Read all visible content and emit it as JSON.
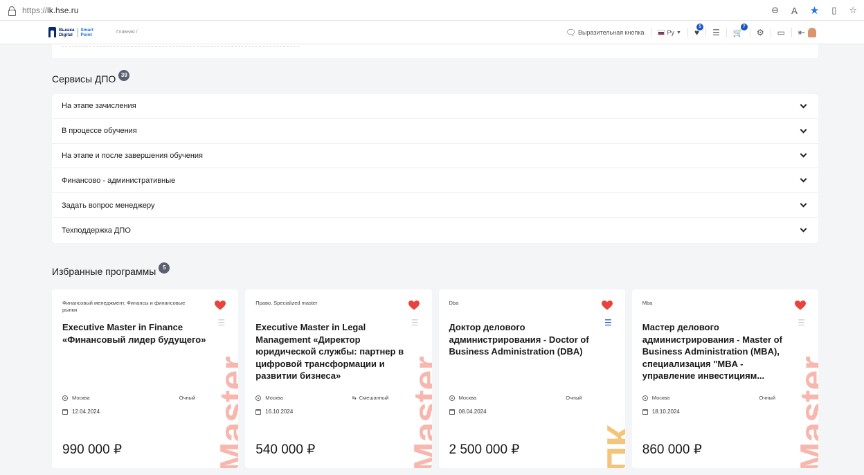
{
  "browser": {
    "url_prefix": "https://",
    "url_host": "lk.hse.ru"
  },
  "header": {
    "logo_line1": "Вышка",
    "logo_line2": "Digital",
    "logo_line3": "Smart",
    "logo_line4": "Point",
    "breadcrumb": "Главная  /",
    "express_button": "Выразительная кнопка",
    "language": "Ру",
    "favorites_count": "5",
    "cart_count": "7"
  },
  "services": {
    "title": "Сервисы ДПО",
    "count": "39",
    "items": [
      {
        "label": "На этапе зачисления"
      },
      {
        "label": "В процессе обучения"
      },
      {
        "label": "На этапе и после завершения обучения"
      },
      {
        "label": "Финансово - административные"
      },
      {
        "label": "Задать вопрос менеджеру"
      },
      {
        "label": "Техподдержка ДПО"
      }
    ]
  },
  "favorites": {
    "title": "Избранные программы",
    "count": "5",
    "cards": [
      {
        "category": "Финансовый менеджмент, Финансы и финансовые рынки",
        "title": "Executive Master in Finance «Финансовый лидер будущего»",
        "location": "Москва",
        "format": "Очный",
        "date": "12.04.2024",
        "price": "990 000 ₽",
        "watermark": "Master",
        "list_active": false
      },
      {
        "category": "Право, Specialized master",
        "title": "Executive Master in Legal Management «Директор юридической службы: партнер в цифровой трансформации и развитии бизнеса»",
        "location": "Москва",
        "format": "Смешанный",
        "date": "16.10.2024",
        "price": "540 000 ₽",
        "watermark": "Master",
        "list_active": false
      },
      {
        "category": "Dba",
        "title": "Доктор делового администрирования - Doctor of Business Administration (DBA)",
        "location": "Москва",
        "format": "Очный",
        "date": "08.04.2024",
        "price": "2 500 000 ₽",
        "watermark": "ПК",
        "list_active": true
      },
      {
        "category": "Mba",
        "title": "Мастер делового администрирования - Master of Business Administration (MBA), специализация \"MBA - управление инвестициям...",
        "location": "Москва",
        "format": "Очный",
        "date": "18.10.2024",
        "price": "860 000 ₽",
        "watermark": "Master",
        "list_active": false
      }
    ]
  },
  "colors": {
    "accent": "#1a55c4",
    "heart": "#e8433c",
    "watermark_master": "#f7b7ae",
    "watermark_pk": "#f3c47a"
  }
}
